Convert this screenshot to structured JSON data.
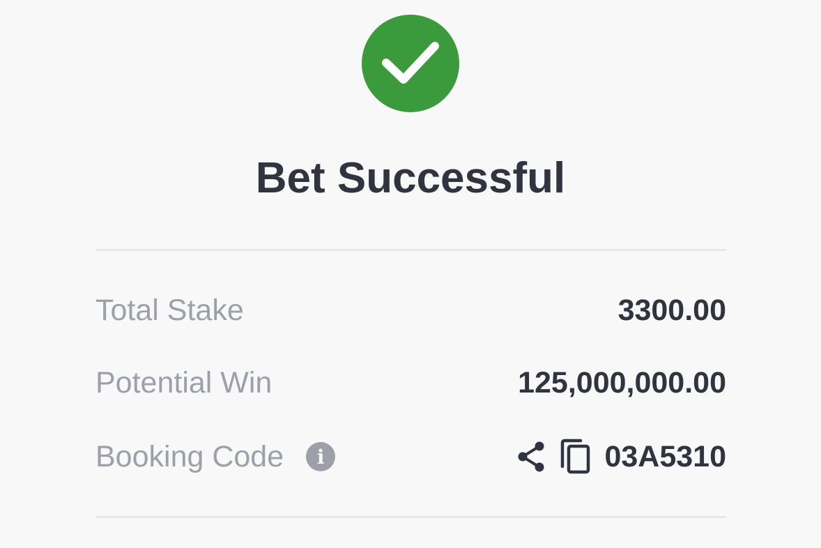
{
  "status": {
    "icon": "check-circle-icon",
    "title": "Bet Successful",
    "success_color": "#3a9a3c"
  },
  "summary": {
    "total_stake_label": "Total Stake",
    "total_stake_value": "3300.00",
    "potential_win_label": "Potential Win",
    "potential_win_value": "125,000,000.00",
    "booking_code_label": "Booking Code",
    "booking_code_value": "03A5310",
    "info_icon": "info-icon",
    "info_glyph": "i",
    "share_icon": "share-icon",
    "copy_icon": "copy-icon"
  }
}
